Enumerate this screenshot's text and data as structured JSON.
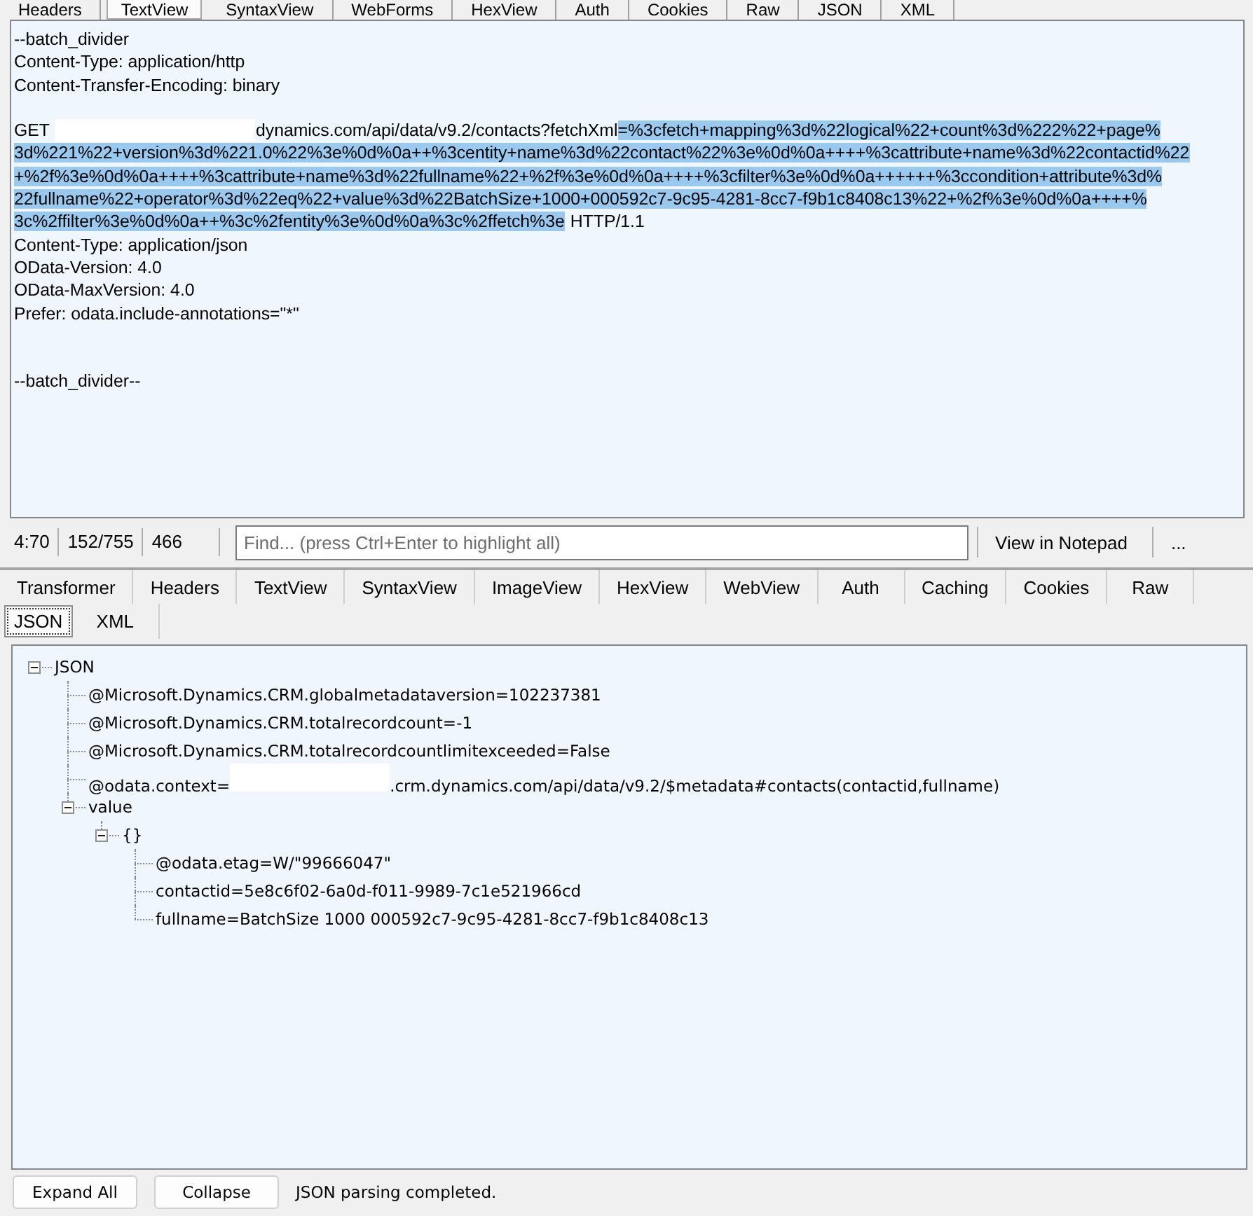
{
  "top_tabs": [
    {
      "label": "Headers",
      "selected": false
    },
    {
      "label": "TextView",
      "selected": true
    },
    {
      "label": "SyntaxView",
      "selected": false
    },
    {
      "label": "WebForms",
      "selected": false
    },
    {
      "label": "HexView",
      "selected": false
    },
    {
      "label": "Auth",
      "selected": false
    },
    {
      "label": "Cookies",
      "selected": false
    },
    {
      "label": "Raw",
      "selected": false
    },
    {
      "label": "JSON",
      "selected": false
    },
    {
      "label": "XML",
      "selected": false
    }
  ],
  "request": {
    "lines": [
      {
        "kind": "text",
        "segments": [
          {
            "kind": "text",
            "text": "--batch_divider",
            "selected": false
          }
        ]
      },
      {
        "kind": "text",
        "segments": [
          {
            "kind": "text",
            "text": "Content-Type: application/http",
            "selected": false
          }
        ]
      },
      {
        "kind": "text",
        "segments": [
          {
            "kind": "text",
            "text": "Content-Transfer-Encoding: binary",
            "selected": false
          }
        ]
      },
      {
        "kind": "blank"
      },
      {
        "kind": "text",
        "segments": [
          {
            "kind": "text",
            "text": "GET",
            "selected": false
          },
          {
            "kind": "redacted"
          },
          {
            "kind": "text",
            "text": "dynamics.com/api/data/v9.2/contacts?fetchXml",
            "selected": false
          },
          {
            "kind": "text",
            "text": "=%3cfetch+mapping%3d%22logical%22+count%3d%222%22+page%",
            "selected": true
          }
        ]
      },
      {
        "kind": "text",
        "segments": [
          {
            "kind": "text",
            "text": "3d%221%22+version%3d%221.0%22%3e%0d%0a++%3centity+name%3d%22contact%22%3e%0d%0a++++%3cattribute+name%3d%22contactid%22",
            "selected": true
          }
        ]
      },
      {
        "kind": "text",
        "segments": [
          {
            "kind": "text",
            "text": "+%2f%3e%0d%0a++++%3cattribute+name%3d%22fullname%22+%2f%3e%0d%0a++++%3cfilter%3e%0d%0a++++++%3ccondition+attribute%3d%",
            "selected": true
          }
        ]
      },
      {
        "kind": "text",
        "segments": [
          {
            "kind": "text",
            "text": "22fullname%22+operator%3d%22eq%22+value%3d%22BatchSize+1000+000592c7-9c95-4281-8cc7-f9b1c8408c13%22+%2f%3e%0d%0a++++%",
            "selected": true
          }
        ]
      },
      {
        "kind": "text",
        "segments": [
          {
            "kind": "text",
            "text": "3c%2ffilter%3e%0d%0a++%3c%2fentity%3e%0d%0a%3c%2ffetch%3e",
            "selected": true
          },
          {
            "kind": "text",
            "text": "HTTP/1.1",
            "selected": false
          }
        ]
      },
      {
        "kind": "text",
        "segments": [
          {
            "kind": "text",
            "text": "Content-Type: application/json",
            "selected": false
          }
        ]
      },
      {
        "kind": "text",
        "segments": [
          {
            "kind": "text",
            "text": "OData-Version: 4.0",
            "selected": false
          }
        ]
      },
      {
        "kind": "text",
        "segments": [
          {
            "kind": "text",
            "text": "OData-MaxVersion: 4.0",
            "selected": false
          }
        ]
      },
      {
        "kind": "text",
        "segments": [
          {
            "kind": "text",
            "text": "Prefer: odata.include-annotations=\"*\"",
            "selected": false
          }
        ]
      },
      {
        "kind": "blank"
      },
      {
        "kind": "blank"
      },
      {
        "kind": "text",
        "segments": [
          {
            "kind": "text",
            "text": "--batch_divider--",
            "selected": false
          }
        ]
      }
    ]
  },
  "request_toolbar": {
    "cells": [
      "4:70",
      "152/755",
      "466"
    ],
    "find": {
      "placeholder": "Find... (press Ctrl+Enter to highlight all)"
    },
    "buttons": [
      "View in Notepad",
      "..."
    ]
  },
  "response_tabs": {
    "rows": [
      {
        "tabs": [
          {
            "label": "Transformer",
            "selected": false
          },
          {
            "label": "Headers",
            "selected": false
          },
          {
            "label": "TextView",
            "selected": false
          },
          {
            "label": "SyntaxView",
            "selected": false
          },
          {
            "label": "ImageView",
            "selected": false
          },
          {
            "label": "HexView",
            "selected": false
          },
          {
            "label": "WebView",
            "selected": false
          },
          {
            "label": "Auth",
            "selected": false
          },
          {
            "label": "Caching",
            "selected": false
          },
          {
            "label": "Cookies",
            "selected": false
          },
          {
            "label": "Raw",
            "selected": false
          }
        ]
      },
      {
        "tabs": [
          {
            "label": "JSON",
            "selected": true
          },
          {
            "label": "XML",
            "selected": false
          }
        ]
      }
    ]
  },
  "tree": [
    {
      "label": "JSON",
      "expanded": true,
      "children": [
        {
          "label": "@Microsoft.Dynamics.CRM.globalmetadataversion=102237381"
        },
        {
          "label": "@Microsoft.Dynamics.CRM.totalrecordcount=-1"
        },
        {
          "label": "@Microsoft.Dynamics.CRM.totalrecordcountlimitexceeded=False"
        },
        {
          "segments": [
            {
              "kind": "text",
              "text": "@odata.context="
            },
            {
              "kind": "redacted"
            },
            {
              "kind": "text",
              "text": ".crm.dynamics.com/api/data/v9.2/$metadata#contacts(contactid,fullname)"
            }
          ]
        },
        {
          "label": "value",
          "expanded": true,
          "children": [
            {
              "label": "{}",
              "expanded": true,
              "children": [
                {
                  "label": "@odata.etag=W/\"99666047\""
                },
                {
                  "label": "contactid=5e8c6f02-6a0d-f011-9989-7c1e521966cd"
                },
                {
                  "label": "fullname=BatchSize 1000 000592c7-9c95-4281-8cc7-f9b1c8408c13"
                }
              ]
            }
          ]
        }
      ]
    }
  ],
  "footer": {
    "buttons": [
      "Expand All",
      "Collapse"
    ],
    "status": "JSON parsing completed."
  }
}
